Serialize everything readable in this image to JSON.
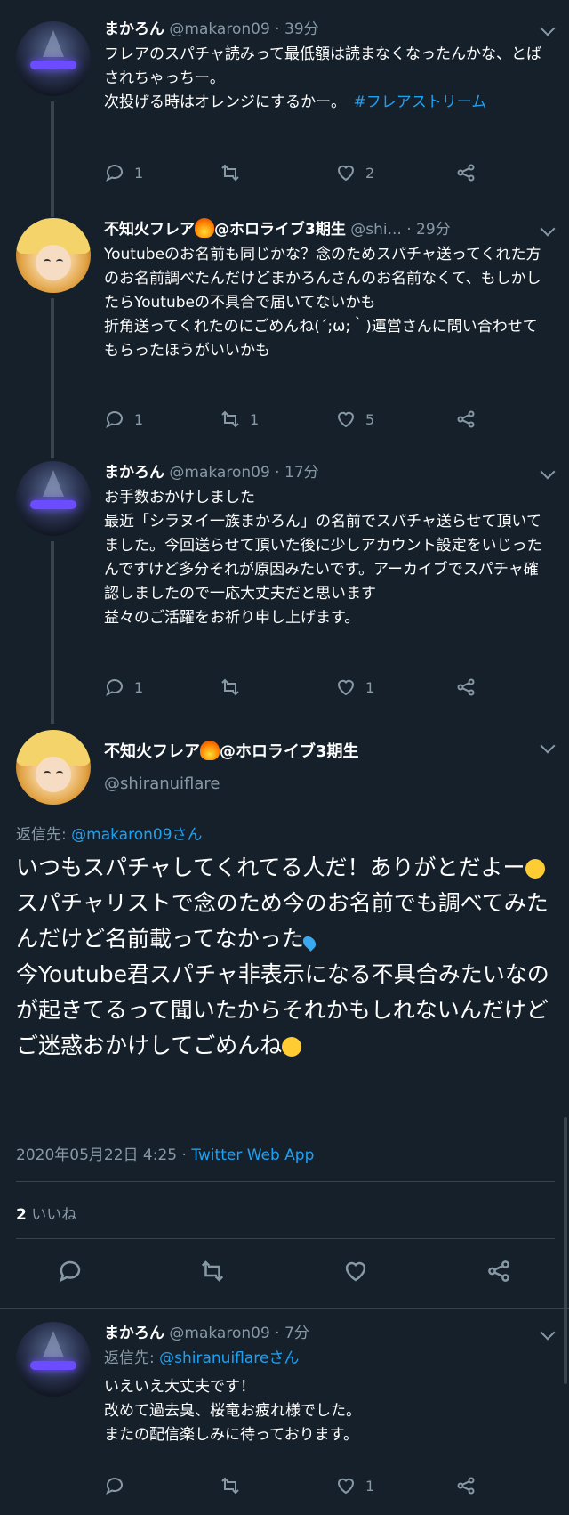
{
  "tweets": [
    {
      "name": "まかろん",
      "handle": "@makaron09",
      "time": "39分",
      "text": "フレアのスパチャ読みって最低額は読まなくなったんかな、とばされちゃっちー。\n次投げる時はオレンジにするかー。",
      "hashtag": "#フレアストリーム",
      "replies": "1",
      "retweets": "",
      "likes": "2"
    },
    {
      "name": "不知火フレア",
      "name_suffix": "@ホロライブ3期生",
      "handle": "@shi...",
      "time": "29分",
      "text": "Youtubeのお名前も同じかな？念のためスパチャ送ってくれた方のお名前調べたんだけどまかろんさんのお名前なくて、もしかしたらYoutubeの不具合で届いてないかも\n折角送ってくれたのにごめんね(´;ω;｀)運営さんに問い合わせてもらったほうがいいかも",
      "replies": "1",
      "retweets": "1",
      "likes": "5"
    },
    {
      "name": "まかろん",
      "handle": "@makaron09",
      "time": "17分",
      "text": "お手数おかけしました\n最近「シラヌイ一族まかろん」の名前でスパチャ送らせて頂いてました。今回送らせて頂いた後に少しアカウント設定をいじったんですけど多分それが原因みたいです。アーカイブでスパチャ確認しましたので一応大丈夫だと思います\n益々のご活躍をお祈り申し上げます。",
      "replies": "1",
      "retweets": "",
      "likes": "1"
    }
  ],
  "main": {
    "name": "不知火フレア",
    "name_suffix": "@ホロライブ3期生",
    "handle": "@shiranuiflare",
    "reply_prefix": "返信先: ",
    "reply_to": "@makaron09さん",
    "text_1": "いつもスパチャしてくれてる人だ！ありがとだよー",
    "text_2": "スパチャリストで念のため今のお名前でも調べてみたんだけど名前載ってなかった",
    "text_3": "\n今Youtube君スパチャ非表示になる不具合みたいなのが起きてるって聞いたからそれかもしれないんだけどご迷惑おかけしてごめんね",
    "timestamp": "2020年05月22日 4:25 · ",
    "app": "Twitter Web App",
    "like_count": "2",
    "like_label": " いいね"
  },
  "reply": {
    "name": "まかろん",
    "handle": "@makaron09",
    "time": "7分",
    "reply_prefix": "返信先: ",
    "reply_to": "@shiranuiflareさん",
    "text": "いえいえ大丈夫です！\n改めて過去臭、桜竜お疲れ様でした。\nまたの配信楽しみに待っております。",
    "replies": "",
    "retweets": "",
    "likes": "1"
  },
  "separator": " · ",
  "icons": [
    "reply-icon",
    "retweet-icon",
    "like-icon",
    "share-icon",
    "chevron-down-icon",
    "fire-emoji",
    "sweat-drops-emoji",
    "crying-emoji",
    "bowing-emoji",
    "eyeroll-emoji"
  ],
  "colors": {
    "background": "#15202b",
    "secondary_text": "#8899a6",
    "link": "#1da1f2",
    "divider": "#38444d"
  }
}
